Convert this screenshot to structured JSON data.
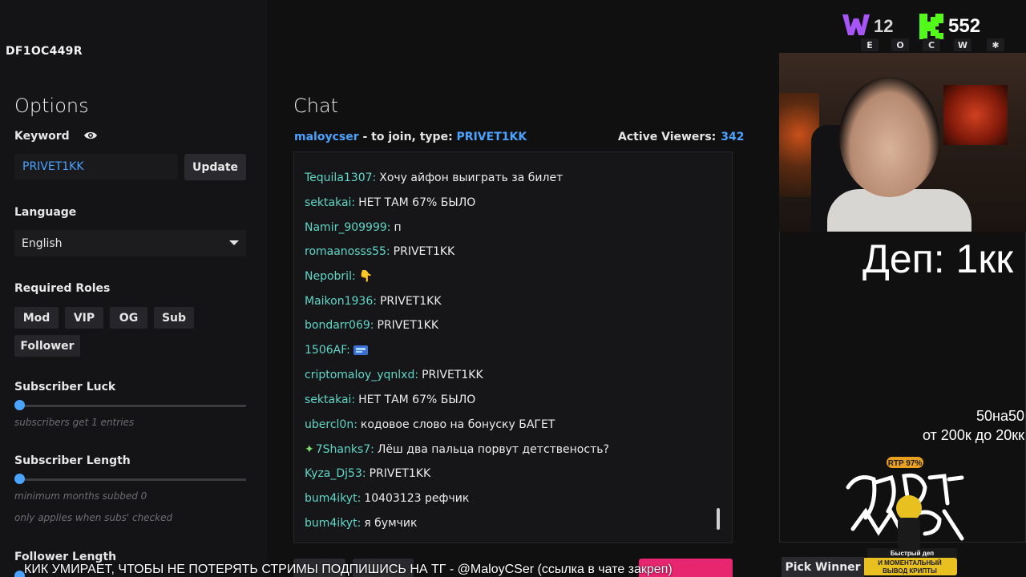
{
  "header": {
    "code": "DF1OC449R"
  },
  "options": {
    "title": "Options",
    "keyword_label": "Keyword",
    "keyword_value": "PRIVET1KK",
    "update_label": "Update",
    "language_label": "Language",
    "language_value": "English",
    "roles_label": "Required Roles",
    "roles": [
      "Mod",
      "VIP",
      "OG",
      "Sub",
      "Follower"
    ],
    "sub_luck_label": "Subscriber Luck",
    "sub_luck_hint": "subscribers get 1 entries",
    "sub_length_label": "Subscriber Length",
    "sub_length_hint": "minimum months subbed 0",
    "sub_length_hint2": "only applies when subs' checked",
    "follower_length_label": "Follower Length"
  },
  "chat": {
    "title": "Chat",
    "streamer": "maloycser",
    "join_text": " - to join, type: ",
    "join_keyword": "PRIVET1KK",
    "viewers_label": "Active Viewers:",
    "viewers_count": "342",
    "messages": [
      {
        "user": "Tequila1307:",
        "text": "Хочу айфон выиграть за билет"
      },
      {
        "user": "sektakai:",
        "text": "НЕТ ТАМ 67% БЫЛО"
      },
      {
        "user": "Namir_909999:",
        "text": "п"
      },
      {
        "user": "romaanosss55:",
        "text": "PRIVET1KK"
      },
      {
        "user": "Nepobril:",
        "text": "👇"
      },
      {
        "user": "Maikon1936:",
        "text": "PRIVET1KK"
      },
      {
        "user": "bondarr069:",
        "text": "PRIVET1KK"
      },
      {
        "user": "1506AF:",
        "text": ""
      },
      {
        "user": "criptomaloy_yqnlxd:",
        "text": "PRIVET1KK"
      },
      {
        "user": "sektakai:",
        "text": "НЕТ ТАМ 67% БЫЛО"
      },
      {
        "user": "ubercl0n:",
        "text": "кодовое слово на бонуску БАГЕТ"
      },
      {
        "user": "7Shanks7:",
        "text": "Лёш два пальца порвут детственость?"
      },
      {
        "user": "Kyza_Dj53:",
        "text": "PRIVET1KK"
      },
      {
        "user": "bum4ikyt:",
        "text": "10403123 рефчик"
      },
      {
        "user": "bum4ikyt:",
        "text": "я бумчик"
      }
    ]
  },
  "overlay": {
    "w_count": "12",
    "k_count": "552",
    "nav_letters": [
      "E",
      "O",
      "C",
      "W",
      "✱"
    ],
    "dep_text": "Деп: 1кк",
    "promo_line1": "50на50",
    "promo_line2": "от 200к до 20кк",
    "pick_winner": "Pick Winner",
    "ticker": "КИК УМИРАЕТ, ЧТОБЫ НЕ ПОТЕРЯТЬ СТРИМЫ ПОДПИШИСЬ НА ТГ - @MaloyCSer (ссылка в чате закреп)",
    "logo_rtp": "RTP 97%",
    "logo_line1": "Быстрый деп",
    "logo_line2": "И МОМЕНТАЛЬНЫЙ",
    "logo_line3": "ВЫВОД КРИПТЫ"
  },
  "colors": {
    "accent_blue": "#4aa3ff",
    "username_teal": "#5ed7c8",
    "kick_green": "#53fc18",
    "pink": "#e8256f"
  }
}
